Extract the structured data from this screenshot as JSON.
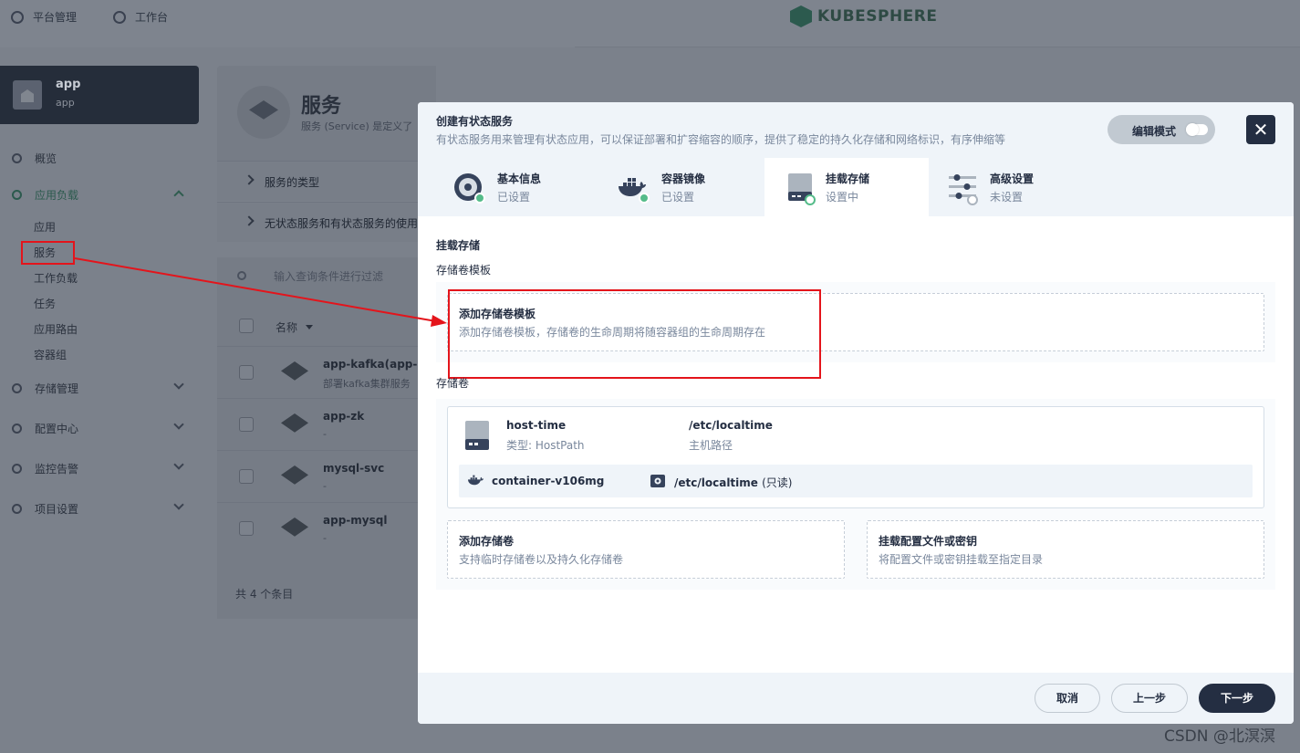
{
  "topnav": {
    "platform": "平台管理",
    "workbench": "工作台",
    "brand": "KUBESPHERE"
  },
  "project": {
    "name": "app",
    "alias": "app"
  },
  "sidebar": {
    "overview": "概览",
    "workloads": "应用负载",
    "workload_items": [
      "应用",
      "服务",
      "工作负载",
      "任务",
      "应用路由",
      "容器组"
    ],
    "storage": "存储管理",
    "config": "配置中心",
    "monitoring": "监控告警",
    "settings": "项目设置"
  },
  "services_page": {
    "title": "服务",
    "desc": "服务 (Service) 是定义了",
    "acc1": "服务的类型",
    "acc2": "无状态服务和有状态服务的使用",
    "search_placeholder": "输入查询条件进行过滤",
    "col_name": "名称",
    "rows": [
      {
        "name": "app-kafka(app-kafk",
        "desc": "部署kafka集群服务"
      },
      {
        "name": "app-zk",
        "desc": "-"
      },
      {
        "name": "mysql-svc",
        "desc": "-"
      },
      {
        "name": "app-mysql",
        "desc": "-"
      }
    ],
    "total": "共 4 个条目"
  },
  "modal": {
    "title": "创建有状态服务",
    "desc": "有状态服务用来管理有状态应用，可以保证部署和扩容缩容的顺序，提供了稳定的持久化存储和网络标识，有序伸缩等",
    "edit_mode": "编辑模式",
    "close": "✕",
    "steps": [
      {
        "title": "基本信息",
        "status": "已设置"
      },
      {
        "title": "容器镜像",
        "status": "已设置"
      },
      {
        "title": "挂载存储",
        "status": "设置中"
      },
      {
        "title": "高级设置",
        "status": "未设置"
      }
    ],
    "section_title": "挂载存储",
    "template_label": "存储卷模板",
    "add_template": {
      "title": "添加存储卷模板",
      "desc": "添加存储卷模板，存储卷的生命周期将随容器组的生命周期存在"
    },
    "volumes_label": "存储卷",
    "volume": {
      "name": "host-time",
      "type": "类型: HostPath",
      "path": "/etc/localtime",
      "path_desc": "主机路径",
      "container": "container-v106mg",
      "mount_path": "/etc/localtime",
      "mount_mode": "(只读)"
    },
    "add_volume": {
      "title": "添加存储卷",
      "desc": "支持临时存储卷以及持久化存储卷"
    },
    "mount_config": {
      "title": "挂载配置文件或密钥",
      "desc": "将配置文件或密钥挂载至指定目录"
    },
    "buttons": {
      "cancel": "取消",
      "prev": "上一步",
      "next": "下一步"
    }
  },
  "watermark": "CSDN @北溟溟",
  "colors": {
    "accent_dark": "#242e42",
    "success": "#55bc8a",
    "highlight": "#e4141b"
  }
}
